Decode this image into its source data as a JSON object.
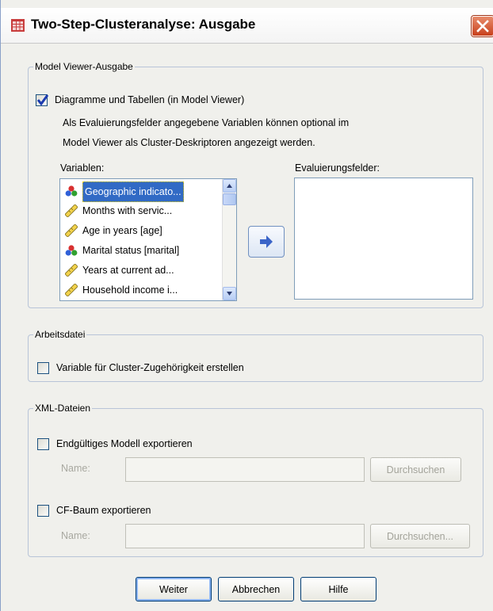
{
  "dialog": {
    "title": "Two-Step-Clusteranalyse: Ausgabe",
    "close_icon": "close-icon"
  },
  "model_viewer": {
    "legend": "Model Viewer-Ausgabe",
    "checkbox_label": "Diagramme und Tabellen (in Model Viewer)",
    "checked": true,
    "description_line1": "Als Evaluierungsfelder angegebene Variablen können optional im",
    "description_line2": "Model Viewer als Cluster-Deskriptoren angezeigt werden.",
    "variables_label": "Variablen:",
    "variables": [
      {
        "label": "Geographic indicato...",
        "icon": "nominal-icon",
        "selected": true
      },
      {
        "label": "Months with servic...",
        "icon": "scale-icon",
        "selected": false
      },
      {
        "label": "Age in years [age]",
        "icon": "scale-icon",
        "selected": false
      },
      {
        "label": "Marital status [marital]",
        "icon": "nominal-icon",
        "selected": false
      },
      {
        "label": "Years at current ad...",
        "icon": "scale-icon",
        "selected": false
      },
      {
        "label": "Household income i...",
        "icon": "scale-icon",
        "selected": false
      }
    ],
    "move_button_icon": "arrow-right-icon",
    "evaluation_label": "Evaluierungsfelder:"
  },
  "working_file": {
    "legend": "Arbeitsdatei",
    "checkbox_label": "Variable für Cluster-Zugehörigkeit erstellen",
    "checked": false
  },
  "xml_files": {
    "legend": "XML-Dateien",
    "export_model_label": "Endgültiges Modell exportieren",
    "export_model_checked": false,
    "name_label_1": "Name:",
    "name_value_1": "",
    "browse_label_1": "Durchsuchen",
    "export_cf_label": "CF-Baum exportieren",
    "export_cf_checked": false,
    "name_label_2": "Name:",
    "name_value_2": "",
    "browse_label_2": "Durchsuchen..."
  },
  "buttons": {
    "continue": "Weiter",
    "cancel": "Abbrechen",
    "help": "Hilfe"
  },
  "colors": {
    "selection": "#316ac5",
    "title_icon": "#c83c3c",
    "close_button": "#d0502c"
  }
}
